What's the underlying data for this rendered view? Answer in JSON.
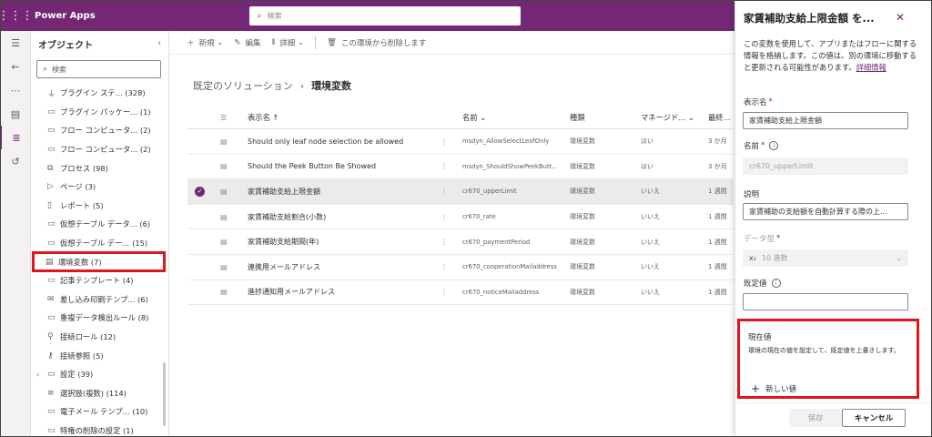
{
  "topbar": {
    "app_name": "Power Apps",
    "search_placeholder": "検索",
    "bg_color": "#742774"
  },
  "objects": {
    "title": "オブジェクト",
    "search_placeholder": "検索",
    "items": [
      {
        "icon": "plugin-step-icon",
        "label": "プラグイン ステ...",
        "count": "(328)"
      },
      {
        "icon": "folder-icon",
        "label": "プラグイン パッケー...",
        "count": "(1)"
      },
      {
        "icon": "folder-icon",
        "label": "フロー コンピュータ...",
        "count": "(2)"
      },
      {
        "icon": "folder-icon",
        "label": "フロー コンピュータ...",
        "count": "(2)"
      },
      {
        "icon": "process-icon",
        "label": "プロセス",
        "count": "(98)"
      },
      {
        "icon": "page-icon",
        "label": "ページ",
        "count": "(3)"
      },
      {
        "icon": "report-icon",
        "label": "レポート",
        "count": "(5)"
      },
      {
        "icon": "folder-icon",
        "label": "仮想テーブル データ...",
        "count": "(6)"
      },
      {
        "icon": "folder-icon",
        "label": "仮想テーブル デー...",
        "count": "(15)"
      },
      {
        "icon": "env-variable-icon",
        "label": "環境変数",
        "count": "(7)"
      },
      {
        "icon": "folder-icon",
        "label": "記事テンプレート",
        "count": "(4)"
      },
      {
        "icon": "mail-merge-icon",
        "label": "差し込み印刷テンプ...",
        "count": "(6)"
      },
      {
        "icon": "folder-icon",
        "label": "重複データ検出ルール",
        "count": "(8)"
      },
      {
        "icon": "connection-role-icon",
        "label": "接続ロール",
        "count": "(12)"
      },
      {
        "icon": "connection-ref-icon",
        "label": "接続参照",
        "count": "(5)"
      },
      {
        "icon": "folder-icon",
        "label": "設定",
        "count": "(39)"
      },
      {
        "icon": "choice-icon",
        "label": "選択肢(複数)",
        "count": "(114)"
      },
      {
        "icon": "folder-icon",
        "label": "電子メール テンプ...",
        "count": "(10)"
      },
      {
        "icon": "folder-icon",
        "label": "特権の削除の設定",
        "count": "(1)"
      }
    ]
  },
  "commands": {
    "new": "新規",
    "edit": "編集",
    "details": "詳細",
    "remove": "この環境から削除します"
  },
  "breadcrumb": {
    "parent": "既定のソリューション",
    "current": "環境変数"
  },
  "grid": {
    "headers": {
      "display": "表示名 ↑",
      "name": "名前",
      "type": "種類",
      "managed": "マネージド...",
      "modified": "最終..."
    },
    "rows": [
      {
        "display": "Should only leaf node selection be allowed",
        "name": "msdyn_AllowSelectLeafOnly",
        "type": "環境変数",
        "managed": "はい",
        "modified": "3 か月",
        "selected": false
      },
      {
        "display": "Should the Peek Button Be Showed",
        "name": "msdyn_ShouldShowPeekButt...",
        "type": "環境変数",
        "managed": "はい",
        "modified": "3 か月",
        "selected": false
      },
      {
        "display": "家賃補助支給上限金額",
        "name": "cr670_upperLimit",
        "type": "環境変数",
        "managed": "いいえ",
        "modified": "1 週間",
        "selected": true
      },
      {
        "display": "家賃補助支給割合(小数)",
        "name": "cr670_rate",
        "type": "環境変数",
        "managed": "いいえ",
        "modified": "1 週間",
        "selected": false
      },
      {
        "display": "家賃補助支給期間(年)",
        "name": "cr670_paymentPeriod",
        "type": "環境変数",
        "managed": "いいえ",
        "modified": "1 週間",
        "selected": false
      },
      {
        "display": "連携用メールアドレス",
        "name": "cr670_cooperationMailaddress",
        "type": "環境変数",
        "managed": "いいえ",
        "modified": "1 週間",
        "selected": false
      },
      {
        "display": "進捗通知用メールアドレス",
        "name": "cr670_noticeMailaddress",
        "type": "環境変数",
        "managed": "いいえ",
        "modified": "1 週間",
        "selected": false
      }
    ]
  },
  "pane": {
    "title": "家賃補助支給上限金額 を...",
    "description": "この変数を使用して、アプリまたはフローに関する情報を格納します。この値は、別の環境に移動すると更新される可能性があります。",
    "link": "詳細情報",
    "display_name_label": "表示名",
    "display_name_value": "家賃補助支給上限金額",
    "name_label": "名前",
    "name_value": "cr670_upperLimit",
    "desc_label": "説明",
    "desc_value": "家賃補助の支給額を自動計算する際の上...",
    "datatype_label": "データ型",
    "datatype_value": "10 進数",
    "default_label": "既定値",
    "default_value": "",
    "current_label": "現在値",
    "current_desc": "環境の現在の値を設定して、既定値を上書きします。",
    "new_value": "新しい値",
    "save": "保存",
    "cancel": "キャンセル"
  },
  "highlight_color": "#e0161a"
}
